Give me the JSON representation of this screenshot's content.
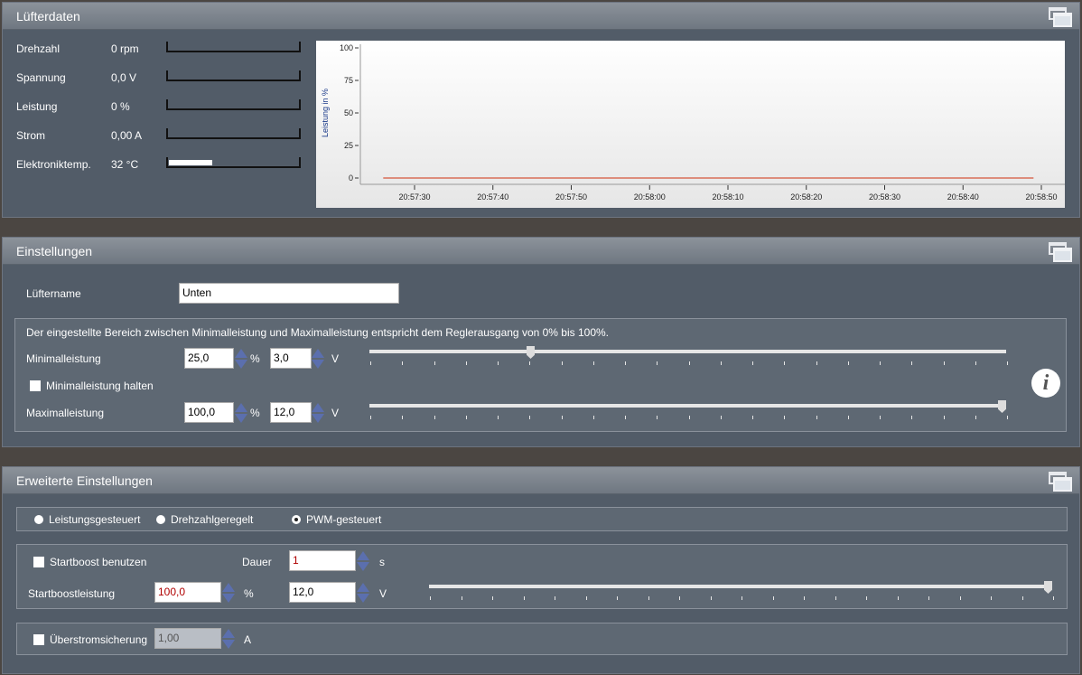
{
  "luefterdaten": {
    "title": "Lüfterdaten",
    "rows": [
      {
        "label": "Drehzahl",
        "value": "0 rpm",
        "level": 0
      },
      {
        "label": "Spannung",
        "value": "0,0 V",
        "level": 0
      },
      {
        "label": "Leistung",
        "value": "0 %",
        "level": 0
      },
      {
        "label": "Strom",
        "value": "0,00 A",
        "level": 0
      },
      {
        "label": "Elektroniktemp.",
        "value": "32 °C",
        "level": 0.33
      }
    ]
  },
  "chart_data": {
    "type": "line",
    "ylabel": "Leistung in %",
    "ylim": [
      0,
      100
    ],
    "yticks": [
      "0",
      "25",
      "50",
      "75",
      "100"
    ],
    "xticks": [
      "20:57:30",
      "20:57:40",
      "20:57:50",
      "20:58:00",
      "20:58:10",
      "20:58:20",
      "20:58:30",
      "20:58:40",
      "20:58:50"
    ],
    "series": [
      {
        "x": [
          "20:57:26",
          "20:58:49"
        ],
        "values": [
          0,
          0
        ],
        "color": "#d03010"
      }
    ],
    "grid": false
  },
  "einstellungen": {
    "title": "Einstellungen",
    "name_label": "Lüftername",
    "name_value": "Unten",
    "info": "Der eingestellte Bereich zwischen Minimalleistung und Maximalleistung entspricht dem Reglerausgang von 0% bis 100%.",
    "min_label": "Minimalleistung",
    "min_percent": "25,0",
    "min_volt": "3,0",
    "min_slider_pct": 25,
    "hold_label": "Minimalleistung halten",
    "max_label": "Maximalleistung",
    "max_percent": "100,0",
    "max_volt": "12,0",
    "max_slider_pct": 100,
    "unit_percent": "%",
    "unit_volt": "V",
    "info_icon": "i"
  },
  "erweitert": {
    "title": "Erweiterte Einstellungen",
    "modes": [
      {
        "label": "Leistungsgesteuert",
        "selected": false
      },
      {
        "label": "Drehzahlgeregelt",
        "selected": false
      },
      {
        "label": "PWM-gesteuert",
        "selected": true
      }
    ],
    "startboost_label": "Startboost benutzen",
    "dauer_label": "Dauer",
    "dauer_value": "1",
    "unit_s": "s",
    "boost_label": "Startboostleistung",
    "boost_percent": "100,0",
    "boost_volt": "12,0",
    "boost_slider_pct": 100,
    "unit_percent": "%",
    "unit_volt": "V",
    "overcurrent_label": "Überstromsicherung",
    "overcurrent_value": "1,00",
    "unit_a": "A"
  }
}
